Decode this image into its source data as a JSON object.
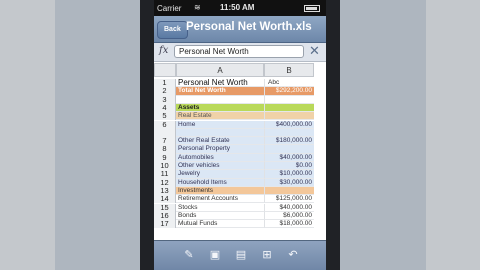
{
  "status": {
    "carrier": "Carrier",
    "wifi": "wifi-icon",
    "time": "11:50 AM"
  },
  "nav": {
    "back_label": "Back",
    "title": "Personal Net Worth.xls"
  },
  "formula": {
    "fx_label": "fx",
    "value": "Personal Net Worth",
    "clear_icon": "close-icon"
  },
  "columns": [
    "A",
    "B"
  ],
  "rows": [
    {
      "num": "1",
      "a": "Personal Net Worth",
      "b": "Abc",
      "style": "title"
    },
    {
      "num": "2",
      "a": "Total Net Worth",
      "b": "$292,200.00",
      "style": "total"
    },
    {
      "num": "3",
      "a": "",
      "b": "",
      "style": "blank"
    },
    {
      "num": "4",
      "a": "Assets",
      "b": "",
      "style": "assets"
    },
    {
      "num": "5",
      "a": "Real Estate",
      "b": "",
      "style": "sub"
    },
    {
      "num": "6",
      "a": "Home",
      "b": "$400,000.00",
      "style": "sel"
    },
    {
      "num": "",
      "a": "",
      "b": "",
      "style": "sel"
    },
    {
      "num": "7",
      "a": "Other Real Estate",
      "b": "$180,000.00",
      "style": "sel"
    },
    {
      "num": "8",
      "a": "Personal Property",
      "b": "",
      "style": "sel"
    },
    {
      "num": "9",
      "a": "Automobiles",
      "b": "$40,000.00",
      "style": "sel"
    },
    {
      "num": "10",
      "a": "Other vehicles",
      "b": "$0.00",
      "style": "sel"
    },
    {
      "num": "11",
      "a": "Jewelry",
      "b": "$10,000.00",
      "style": "sel"
    },
    {
      "num": "12",
      "a": "Household Items",
      "b": "$30,000.00",
      "style": "sel"
    },
    {
      "num": "13",
      "a": "Investments",
      "b": "",
      "style": "invest"
    },
    {
      "num": "14",
      "a": "Retirement Accounts",
      "b": "$125,000.00",
      "style": "plain"
    },
    {
      "num": "15",
      "a": "Stocks",
      "b": "$40,000.00",
      "style": "plain"
    },
    {
      "num": "16",
      "a": "Bonds",
      "b": "$6,000.00",
      "style": "plain"
    },
    {
      "num": "17",
      "a": "Mutual Funds",
      "b": "$18,000.00",
      "style": "plain"
    }
  ],
  "toolbar": [
    "edit-icon",
    "excel-icon",
    "document-icon",
    "add-sheet-icon",
    "undo-icon"
  ],
  "colors": {
    "total": "#e79a66",
    "assets": "#b9d95a",
    "sub": "#f0d2a8",
    "selection": "#dbe7f5",
    "invest": "#f3c79a"
  }
}
